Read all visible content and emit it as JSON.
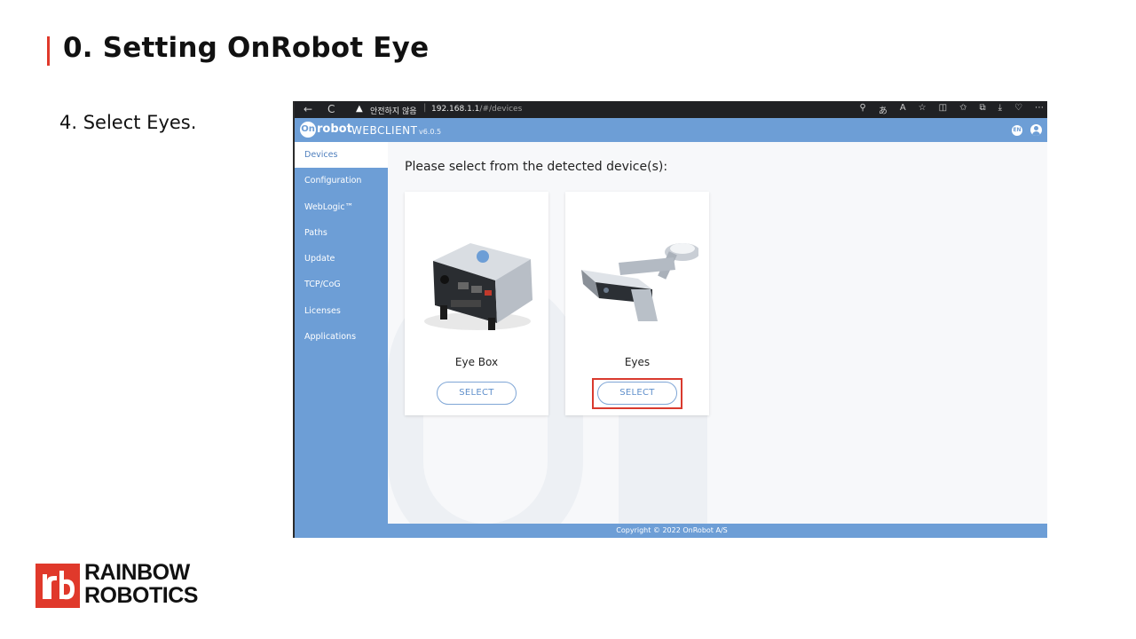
{
  "slide": {
    "title": "0. Setting OnRobot Eye",
    "step": "4. Select Eyes."
  },
  "browser": {
    "back_glyph": "←",
    "refresh_glyph": "C",
    "warning_glyph": "▲",
    "security_text": "안전하지 않음",
    "separator": "|",
    "url_host": "192.168.1.1",
    "url_path": "/#/devices",
    "tool_icons": [
      "key-icon",
      "translate-icon",
      "read-aloud-icon",
      "favorite-icon",
      "split-screen-icon",
      "favorites-icon",
      "collections-icon",
      "downloads-icon",
      "health-icon",
      "more-icon"
    ],
    "tool_glyphs": [
      "⚲",
      "あ",
      "A",
      "☆",
      "◫",
      "✩",
      "⧉",
      "⤓",
      "♡",
      "⋯"
    ]
  },
  "app": {
    "logo_badge": "On",
    "logo_word": "robot",
    "name": "WEBCLIENT",
    "version": "v6.0.5",
    "lang_badge": "EN"
  },
  "sidebar": {
    "items": [
      {
        "label": "Devices",
        "active": true
      },
      {
        "label": "Configuration"
      },
      {
        "label": "WebLogic™"
      },
      {
        "label": "Paths"
      },
      {
        "label": "Update"
      },
      {
        "label": "TCP/CoG"
      },
      {
        "label": "Licenses"
      },
      {
        "label": "Applications"
      }
    ]
  },
  "main": {
    "prompt": "Please select from the detected device(s):",
    "devices": [
      {
        "name": "Eye Box",
        "button": "SELECT"
      },
      {
        "name": "Eyes",
        "button": "SELECT",
        "highlighted": true
      }
    ]
  },
  "footer": {
    "copyright": "Copyright © 2022 OnRobot A/S"
  },
  "brand": {
    "line1": "RAINBOW",
    "line2": "ROBOTICS",
    "accent": "#e0392b"
  }
}
